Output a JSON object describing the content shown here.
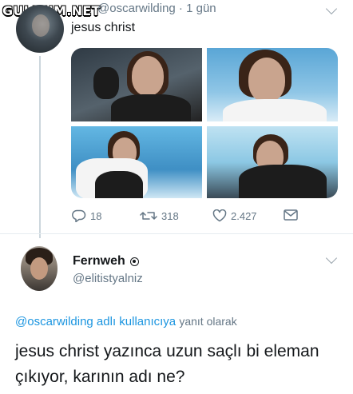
{
  "watermark": {
    "text": "GULDUM.NET"
  },
  "tweet1": {
    "handle_time": "@oscarwilding · 1 gün",
    "text": "jesus christ",
    "stats": {
      "replies": "18",
      "retweets": "318",
      "likes": "2.427"
    }
  },
  "tweet2": {
    "name": "Fernweh",
    "handle": "@elitistyalniz",
    "reply_to_link": "@oscarwilding adlı kullanıcıya",
    "reply_to_suffix": "yanıt olarak",
    "text": "jesus christ yazınca uzun saçlı bi eleman çıkıyor, karının adı ne?"
  },
  "icons": [
    "reply-icon",
    "retweet-icon",
    "like-icon",
    "message-icon",
    "chevron-down-icon",
    "badge-icon"
  ],
  "colors": {
    "link": "#1b95e0",
    "muted": "#657786",
    "text": "#14171a"
  }
}
